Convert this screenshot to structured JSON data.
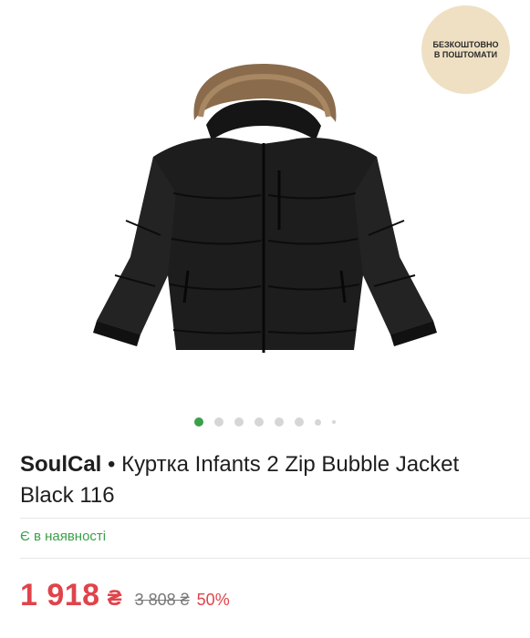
{
  "badge": {
    "line1": "БЕЗКОШТОВНО",
    "line2": "В ПОШТОМАТИ"
  },
  "gallery": {
    "image_icon": "puffer-jacket-image",
    "dots_total": 8,
    "active_dot": 1
  },
  "product": {
    "brand": "SoulCal",
    "separator": " • ",
    "name": "Куртка Infants 2 Zip Bubble Jacket Black 116"
  },
  "stock": "Є в наявності",
  "price": {
    "current": "1 918",
    "currency": "₴",
    "old": "3 808 ₴",
    "discount": "50%"
  },
  "colors": {
    "accent_green": "#3aa04a",
    "sale_red": "#e0434b",
    "badge_bg": "#efe0c3"
  }
}
